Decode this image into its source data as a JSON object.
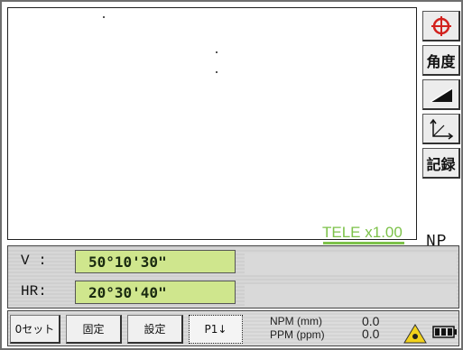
{
  "viewport": {
    "zoom": "TELE x1.00",
    "mode": "NP"
  },
  "toolbar": {
    "items": [
      {
        "icon": "crosshair-icon",
        "label": ""
      },
      {
        "icon": "",
        "label": "角度"
      },
      {
        "icon": "slope-icon",
        "label": ""
      },
      {
        "icon": "axes-icon",
        "label": ""
      },
      {
        "icon": "",
        "label": "記録"
      }
    ]
  },
  "readout": {
    "v_label": "V :",
    "v_value": "50°10'30\"",
    "hr_label": "HR:",
    "hr_value": "20°30'40\""
  },
  "bottom": {
    "btn_zero": "0セット",
    "btn_hold": "固定",
    "btn_settings": "設定",
    "btn_page": "P1↓",
    "npm_label": "NPM (mm)",
    "ppm_label": "PPM (ppm)",
    "npm_value": "0.0",
    "ppm_value": "0.0"
  },
  "colors": {
    "value_bg": "#cfe68d",
    "tele_text": "#7dc24a",
    "crosshair": "#d2221e",
    "warning": "#f2d21c"
  }
}
